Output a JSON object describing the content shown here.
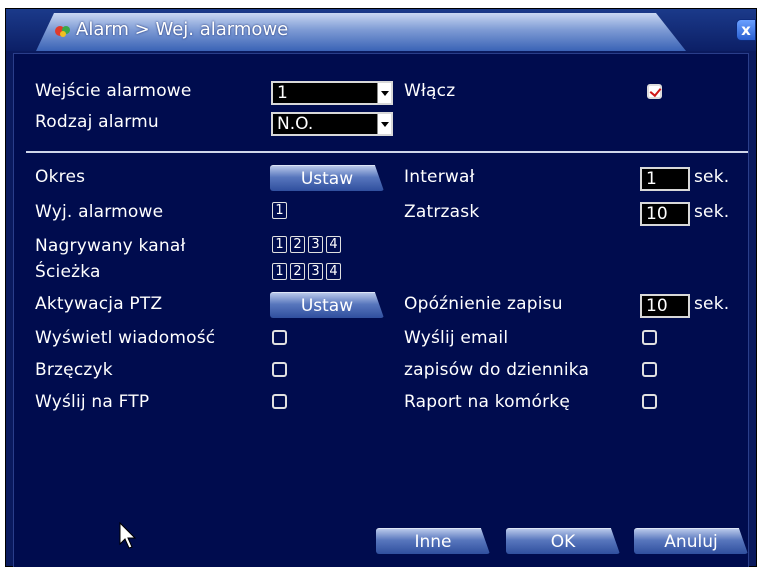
{
  "title": "Alarm > Wej. alarmowe",
  "close_label": "x",
  "fields": {
    "alarm_input_label": "Wejście alarmowe",
    "alarm_input_value": "1",
    "enable_label": "Włącz",
    "enable_checked": true,
    "alarm_type_label": "Rodzaj alarmu",
    "alarm_type_value": "N.O."
  },
  "rows": {
    "period_label": "Okres",
    "set_label": "Ustaw",
    "interval_label": "Interwał",
    "interval_value": "1",
    "sec_label": "sek.",
    "alarm_out_label": "Wyj. alarmowe",
    "latch_label": "Zatrzask",
    "latch_value": "10",
    "record_channel_label": "Nagrywany kanał",
    "path_label": "Ścieżka",
    "ptz_label": "Aktywacja PTZ",
    "ptz_set_label": "Ustaw",
    "record_delay_label": "Opóźnienie zapisu",
    "record_delay_value": "10",
    "show_msg_label": "Wyświetl wiadomość",
    "send_email_label": "Wyślij email",
    "buzzer_label": "Brzęczyk",
    "log_label": "zapisów do dziennika",
    "ftp_label": "Wyślij na FTP",
    "mobile_label": "Raport na komórkę"
  },
  "channels": [
    "1",
    "2",
    "3",
    "4"
  ],
  "alarm_outputs": [
    "1"
  ],
  "buttons": {
    "other": "Inne",
    "ok": "OK",
    "cancel": "Anuluj"
  },
  "colors": {
    "background": "#000c4e",
    "title_accent": "#7d9ad4",
    "check_mark": "#d01818"
  }
}
